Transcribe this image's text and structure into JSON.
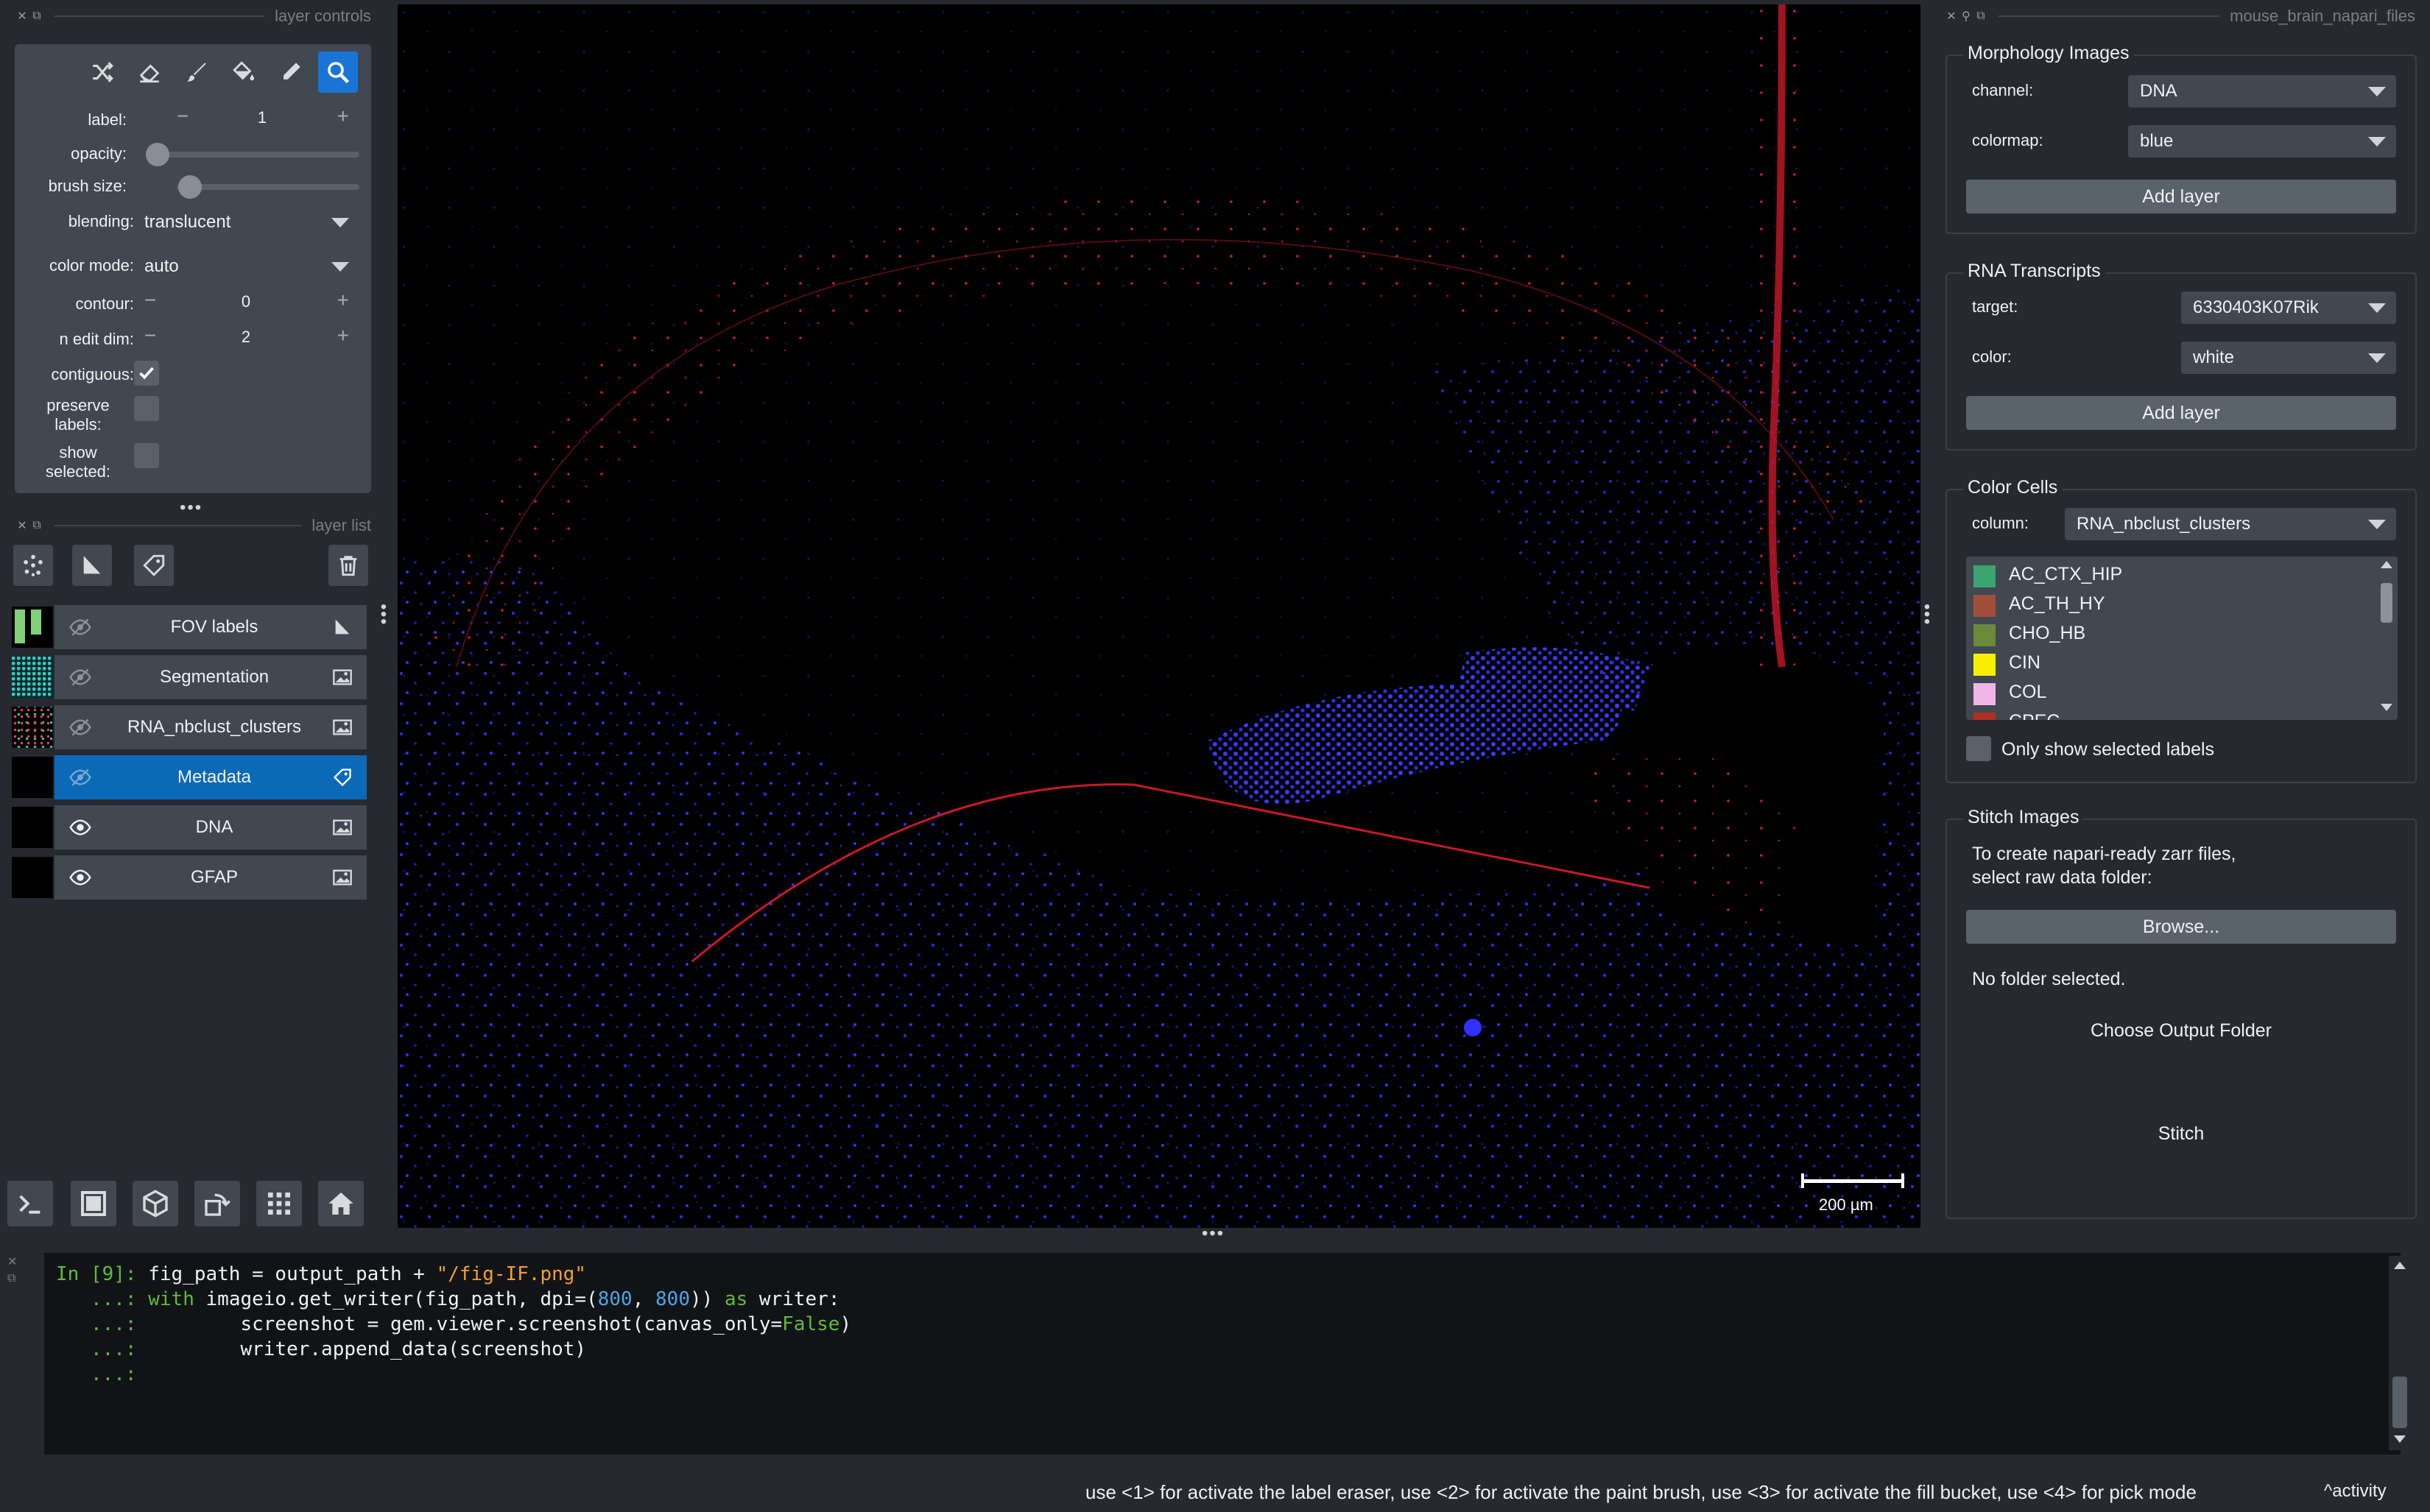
{
  "left_dock": {
    "controls_title": "layer controls",
    "list_title": "layer list",
    "fields": {
      "label": {
        "label": "label:",
        "value": "1"
      },
      "opacity": {
        "label": "opacity:",
        "level": 0.0
      },
      "brush_size": {
        "label": "brush size:",
        "level": 0.1
      },
      "blending": {
        "label": "blending:",
        "value": "translucent"
      },
      "color_mode": {
        "label": "color mode:",
        "value": "auto"
      },
      "contour": {
        "label": "contour:",
        "value": "0"
      },
      "n_edit_dim": {
        "label": "n edit dim:",
        "value": "2"
      },
      "contiguous": {
        "label": "contiguous:",
        "checked": true
      },
      "preserve_labels": {
        "label_line1": "preserve",
        "label_line2": "labels:",
        "checked": false
      },
      "show_selected": {
        "label_line1": "show",
        "label_line2": "selected:",
        "checked": false
      }
    },
    "tools": [
      "shuffle-icon",
      "eraser-icon",
      "brush-icon",
      "fill-bucket-icon",
      "picker-icon",
      "zoom-icon"
    ],
    "active_tool": "zoom-icon",
    "layers": [
      {
        "name": "FOV labels",
        "visible": false,
        "type": "shapes"
      },
      {
        "name": "Segmentation",
        "visible": false,
        "type": "image"
      },
      {
        "name": "RNA_nbclust_clusters",
        "visible": false,
        "type": "image"
      },
      {
        "name": "Metadata",
        "visible": false,
        "type": "points",
        "selected": true
      },
      {
        "name": "DNA",
        "visible": true,
        "type": "image"
      },
      {
        "name": "GFAP",
        "visible": true,
        "type": "image"
      }
    ]
  },
  "canvas": {
    "scale_bar": "200 µm"
  },
  "right_dock": {
    "title": "mouse_brain_napari_files",
    "morphology": {
      "title": "Morphology Images",
      "channel_label": "channel:",
      "channel_value": "DNA",
      "colormap_label": "colormap:",
      "colormap_value": "blue",
      "add_button": "Add layer"
    },
    "rna": {
      "title": "RNA Transcripts",
      "target_label": "target:",
      "target_value": "6330403K07Rik",
      "color_label": "color:",
      "color_value": "white",
      "add_button": "Add layer"
    },
    "color_cells": {
      "title": "Color Cells",
      "column_label": "column:",
      "column_value": "RNA_nbclust_clusters",
      "items": [
        {
          "label": "AC_CTX_HIP",
          "color": "#3aa56e"
        },
        {
          "label": "AC_TH_HY",
          "color": "#a0503a"
        },
        {
          "label": "CHO_HB",
          "color": "#6b8a3a"
        },
        {
          "label": "CIN",
          "color": "#f6f000"
        },
        {
          "label": "COL",
          "color": "#f0b6e8"
        },
        {
          "label": "CPEC",
          "color": "#b03020"
        }
      ],
      "only_selected_label": "Only show selected labels"
    },
    "stitch": {
      "title": "Stitch Images",
      "desc_line1": "To create napari-ready zarr files,",
      "desc_line2": "select raw data folder:",
      "browse_button": "Browse...",
      "status": "No folder selected.",
      "output_button": "Choose Output Folder",
      "stitch_button": "Stitch"
    }
  },
  "console": {
    "lines": [
      {
        "prompt": "In [9]: ",
        "parts": [
          [
            "t",
            "fig_path = output_path + "
          ],
          [
            "s",
            "\"/fig-IF.png\""
          ]
        ]
      },
      {
        "prompt": "   ...: ",
        "parts": [
          [
            "g",
            "with"
          ],
          [
            "t",
            " imageio.get_writer(fig_path, dpi=("
          ],
          [
            "n",
            "800"
          ],
          [
            "t",
            ", "
          ],
          [
            "n",
            "800"
          ],
          [
            "t",
            ")) "
          ],
          [
            "g",
            "as"
          ],
          [
            "t",
            " writer:"
          ]
        ]
      },
      {
        "prompt": "   ...: ",
        "parts": [
          [
            "t",
            "        screenshot = gem.viewer.screenshot(canvas_only="
          ],
          [
            "g",
            "False"
          ],
          [
            "t",
            ")"
          ]
        ]
      },
      {
        "prompt": "   ...: ",
        "parts": [
          [
            "t",
            "        writer.append_data(screenshot)"
          ]
        ]
      },
      {
        "prompt": "   ...: ",
        "parts": []
      }
    ]
  },
  "status_bar": {
    "message": "use <1> for activate the label eraser, use <2> for activate the paint brush, use <3> for activate the fill bucket, use <4> for pick mode",
    "activity": "activity"
  }
}
